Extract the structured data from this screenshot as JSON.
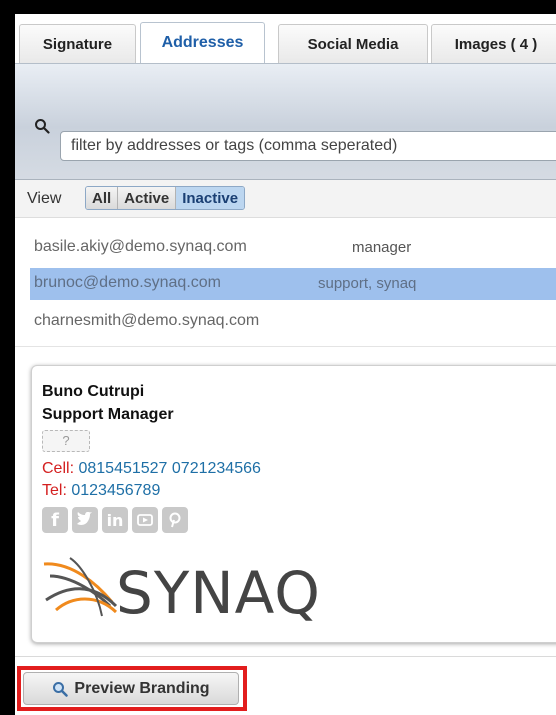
{
  "tabs": [
    {
      "label": "Signature"
    },
    {
      "label": "Addresses"
    },
    {
      "label": "Social Media"
    },
    {
      "label": "Images ( 4 )"
    }
  ],
  "filter": {
    "placeholder": "filter by addresses or tags (comma seperated)",
    "value": ""
  },
  "view": {
    "label": "View",
    "options": [
      {
        "label": "All"
      },
      {
        "label": "Active"
      },
      {
        "label": "Inactive"
      }
    ],
    "selected": "Inactive"
  },
  "addresses": [
    {
      "email": "basile.akiy@demo.synaq.com",
      "tags": "manager"
    },
    {
      "email": "brunoc@demo.synaq.com",
      "tags": "support, synaq"
    },
    {
      "email": "charnesmith@demo.synaq.com",
      "tags": ""
    }
  ],
  "signature": {
    "name": "Buno Cutrupi",
    "title": "Support Manager",
    "placeholder": "?",
    "cell_label": "Cell:",
    "cell_value": "0815451527 0721234566",
    "tel_label": "Tel:",
    "tel_value": "0123456789",
    "social_icons": [
      "facebook-icon",
      "twitter-icon",
      "linkedin-icon",
      "youtube-icon",
      "pinterest-icon"
    ],
    "logo_text": "SYNAQ"
  },
  "footer": {
    "preview_label": "Preview Branding"
  },
  "colors": {
    "accent": "#1f5fa8",
    "selected_row": "#9ec0ed",
    "highlight": "#e21d1d",
    "label_red": "#d42020",
    "phone_blue": "#1e6fa6",
    "logo_orange": "#f08a1d"
  }
}
